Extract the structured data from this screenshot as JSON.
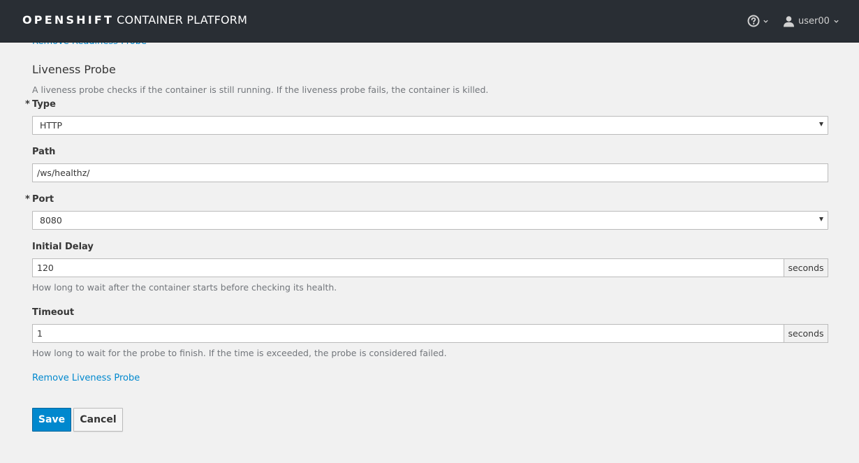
{
  "header": {
    "brand_bold": "OPENSHIFT",
    "brand_thin": "CONTAINER PLATFORM",
    "help_icon": "question-circle-icon",
    "user_icon": "user-icon",
    "username": "user00"
  },
  "form": {
    "prev_link": "Remove Readiness Probe",
    "section_title": "Liveness Probe",
    "section_help": "A liveness probe checks if the container is still running. If the liveness probe fails, the container is killed.",
    "type": {
      "required_mark": "*",
      "label": "Type",
      "value": "HTTP"
    },
    "path": {
      "label": "Path",
      "value": "/ws/healthz/"
    },
    "port": {
      "required_mark": "*",
      "label": "Port",
      "value": "8080"
    },
    "initial_delay": {
      "label": "Initial Delay",
      "value": "120",
      "unit": "seconds",
      "help": "How long to wait after the container starts before checking its health."
    },
    "timeout": {
      "label": "Timeout",
      "value": "1",
      "unit": "seconds",
      "help": "How long to wait for the probe to finish. If the time is exceeded, the probe is considered failed."
    },
    "remove_link": "Remove Liveness Probe",
    "save_label": "Save",
    "cancel_label": "Cancel"
  }
}
